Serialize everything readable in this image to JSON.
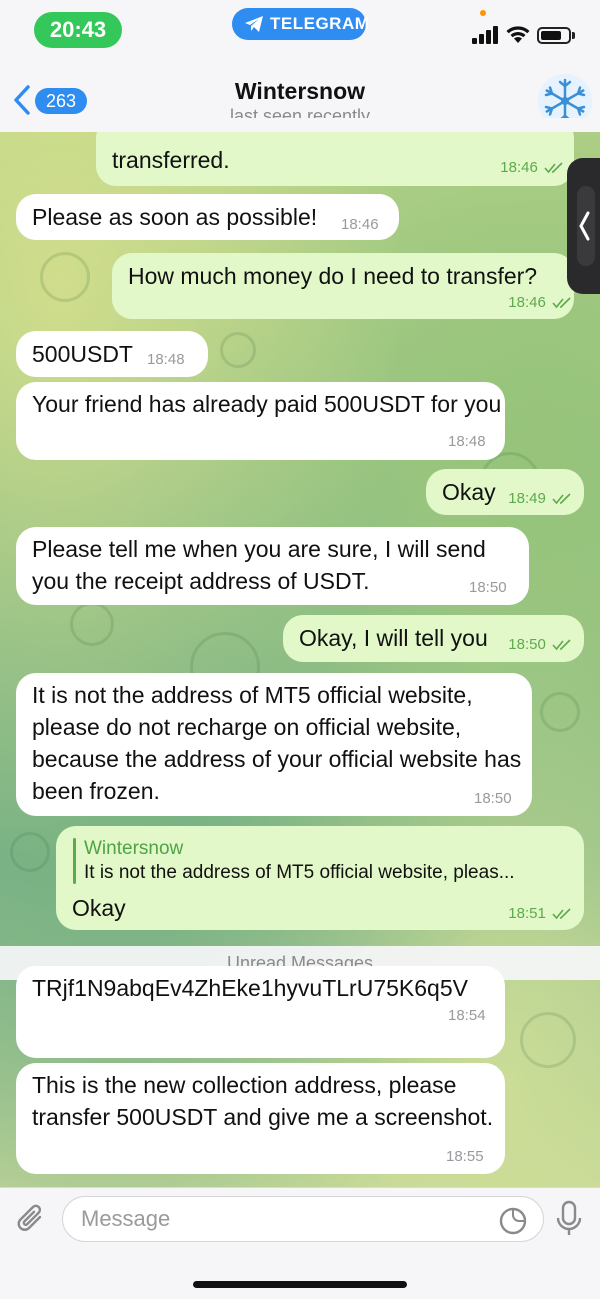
{
  "status_bar": {
    "time": "20:43",
    "app_pill": "TELEGRAM"
  },
  "header": {
    "back_count": "263",
    "title": "Wintersnow",
    "subtitle": "last seen recently"
  },
  "messages": [
    {
      "dir": "out",
      "text": "transferred.",
      "time": "18:46",
      "read": true
    },
    {
      "dir": "in",
      "text": "Please as soon as possible!",
      "time": "18:46"
    },
    {
      "dir": "out",
      "text": "How much money do I need to transfer?",
      "time": "18:46",
      "read": true
    },
    {
      "dir": "in",
      "text": "500USDT",
      "time": "18:48"
    },
    {
      "dir": "in",
      "text": "Your friend has already paid 500USDT for you",
      "time": "18:48"
    },
    {
      "dir": "out",
      "text": "Okay",
      "time": "18:49",
      "read": true
    },
    {
      "dir": "in",
      "text": "Please tell me when you are sure, I will send you the receipt address of USDT.",
      "time": "18:50"
    },
    {
      "dir": "out",
      "text": "Okay, I will tell you",
      "time": "18:50",
      "read": true
    },
    {
      "dir": "in",
      "text": "It is not the address of MT5 official website, please do not recharge on official website, because the address of your official website has been frozen.",
      "time": "18:50"
    },
    {
      "dir": "out",
      "reply_name": "Wintersnow",
      "reply_text": "It is not the address of MT5 official website, pleas...",
      "text": "Okay",
      "time": "18:51",
      "read": true
    },
    {
      "dir": "in",
      "text": "TRjf1N9abqEv4ZhEke1hyvuTLrU75K6q5V",
      "time": "18:54"
    },
    {
      "dir": "in",
      "text": "This is the new collection address, please transfer 500USDT and give me a screenshot.",
      "time": "18:55"
    }
  ],
  "unread_label": "Unread Messages",
  "composer": {
    "placeholder": "Message"
  },
  "colors": {
    "accent": "#2f8cf1",
    "outgoing_bubble": "#e2f8c9",
    "incoming_bubble": "#ffffff",
    "status_green": "#34c759"
  },
  "icons": [
    "telegram-plane-icon",
    "signal-icon",
    "wifi-icon",
    "battery-icon",
    "back-chevron-icon",
    "double-check-icon",
    "paperclip-icon",
    "sticker-icon",
    "microphone-icon"
  ]
}
